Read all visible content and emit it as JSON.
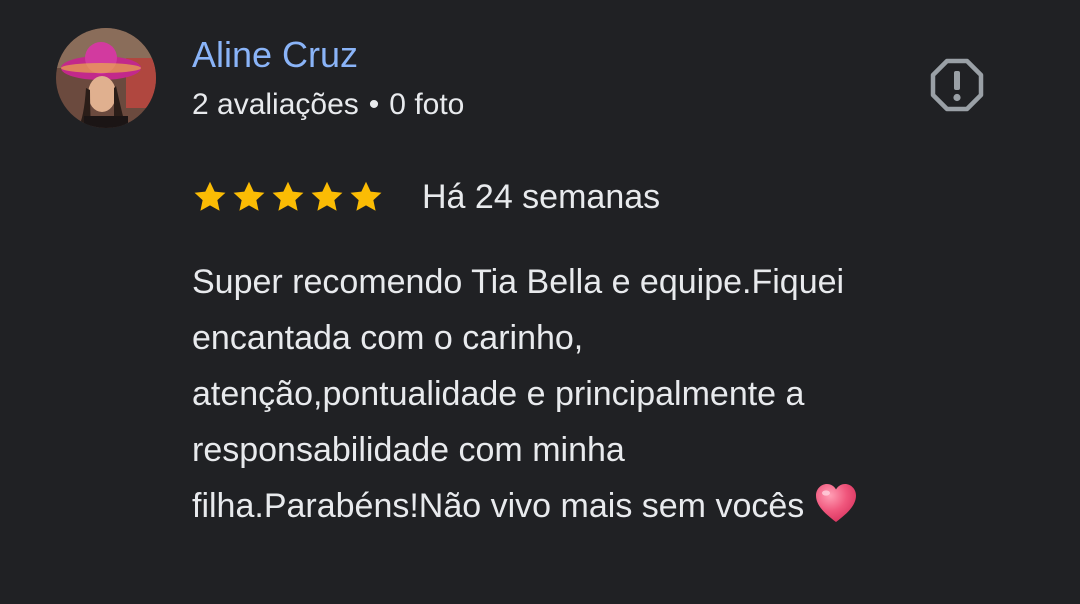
{
  "reviewer": {
    "name": "Aline Cruz",
    "reviews_count": "2 avaliações",
    "separator": "•",
    "photos_count": "0 foto",
    "avatar": "profile-photo"
  },
  "report_icon": "report-flag-icon",
  "rating": {
    "stars": 5,
    "max": 5,
    "star_color": "#fbbc04",
    "time": "Há 24 semanas"
  },
  "review": {
    "lines": [
      "Super recomendo Tia Bella e equipe.Fiquei",
      "encantada com o carinho,",
      "atenção,pontualidade e principalmente a",
      "responsabilidade com minha",
      "filha.Parabéns!Não vivo mais sem vocês"
    ],
    "emoji": "heart-emoji"
  },
  "colors": {
    "background": "#202124",
    "name": "#8ab4f8",
    "text": "#e8eaed",
    "icon": "#9aa0a6"
  }
}
